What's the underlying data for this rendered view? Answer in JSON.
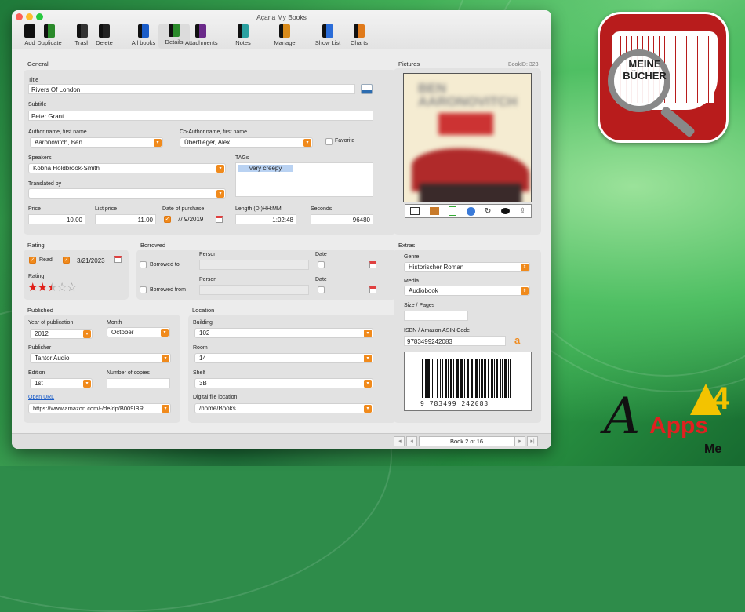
{
  "window": {
    "title": "Açana My Books"
  },
  "toolbar": [
    {
      "name": "add",
      "label": "Add",
      "icon": "add-book-icon"
    },
    {
      "name": "duplicate",
      "label": "Duplicate",
      "icon": "duplicate-icon"
    },
    {
      "name": "trash",
      "label": "Trash",
      "icon": "trash-icon"
    },
    {
      "name": "delete",
      "label": "Delete",
      "icon": "delete-icon"
    },
    {
      "name": "all-books",
      "label": "All books",
      "icon": "all-books-icon"
    },
    {
      "name": "details",
      "label": "Details",
      "icon": "details-icon"
    },
    {
      "name": "attachments",
      "label": "Attachments",
      "icon": "attachments-icon"
    },
    {
      "name": "notes",
      "label": "Notes",
      "icon": "notes-icon"
    },
    {
      "name": "manage",
      "label": "Manage",
      "icon": "manage-icon"
    },
    {
      "name": "show-list",
      "label": "Show List",
      "icon": "list-icon"
    },
    {
      "name": "charts",
      "label": "Charts",
      "icon": "charts-icon"
    }
  ],
  "general": {
    "section": "General",
    "title_label": "Title",
    "title": "Rivers Of London",
    "subtitle_label": "Subtitle",
    "subtitle": "Peter Grant",
    "author_label": "Author name, first name",
    "author": "Aaronovitch, Ben",
    "coauthor_label": "Co-Author name, first name",
    "coauthor": "Überflieger, Alex",
    "favorite_label": "Favorite",
    "speakers_label": "Speakers",
    "speakers": "Kobna Holdbrook-Smith",
    "tags_label": "TAGs",
    "tag": "very creepy",
    "translated_label": "Translated by",
    "translated": "",
    "price_label": "Price",
    "price": "10.00",
    "listprice_label": "List price",
    "listprice": "11.00",
    "purchase_label": "Date of purchase",
    "purchase": "7/  9/2019",
    "length_label": "Length (D:)HH:MM",
    "length": "1:02:48",
    "seconds_label": "Seconds",
    "seconds": "96480"
  },
  "rating": {
    "section": "Rating",
    "read_label": "Read",
    "read_date": "3/21/2023",
    "rating_label": "Rating",
    "stars": 2.5,
    "max": 5
  },
  "borrowed": {
    "section": "Borrowed",
    "person_label": "Person",
    "date_label": "Date",
    "to_label": "Borrowed to",
    "from_label": "Borrowed from"
  },
  "published": {
    "section": "Published",
    "year_label": "Year of publication",
    "year": "2012",
    "month_label": "Month",
    "month": "October",
    "publisher_label": "Publisher",
    "publisher": "Tantor Audio",
    "edition_label": "Edition",
    "edition": "1st",
    "copies_label": "Number of copies",
    "copies": "",
    "url_label": "Open URL",
    "url": "https://www.amazon.com/-/de/dp/B009IBR"
  },
  "location": {
    "section": "Location",
    "building_label": "Building",
    "building": "102",
    "room_label": "Room",
    "room": "14",
    "shelf_label": "Shelf",
    "shelf": "3B",
    "file_label": "Digital file location",
    "file": "/home/Books"
  },
  "pictures": {
    "section": "Pictures",
    "bookid": "BookID: 323",
    "cover_author": "BEN AARONOVITCH"
  },
  "extras": {
    "section": "Extras",
    "genre_label": "Genre",
    "genre": "Historischer Roman",
    "media_label": "Media",
    "media": "Audiobook",
    "size_label": "Size / Pages",
    "size": "",
    "isbn_label": "ISBN / Amazon ASIN Code",
    "isbn": "9783499242083",
    "barcode": "9  783499  242083"
  },
  "nav": {
    "record": "Book  2 of 16"
  },
  "promo": {
    "logo_line1": "MEINE",
    "logo_line2": "BÜCHER",
    "brand": "Apps",
    "brand_num": "4",
    "brand_me": "Me"
  },
  "colors": {
    "accent": "#f08a1c",
    "tag": "#b9d2f2",
    "stars": "#e0201a"
  }
}
